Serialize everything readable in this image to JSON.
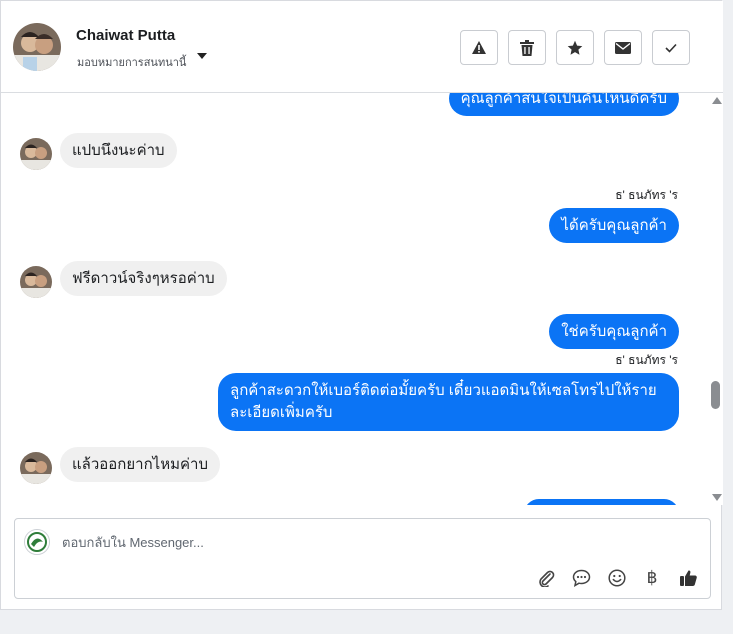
{
  "header": {
    "user_name": "Chaiwat Putta",
    "subtitle": "มอบหมายการสนทนานี้",
    "buttons": [
      {
        "icon": "warning-icon",
        "label": "report"
      },
      {
        "icon": "trash-icon",
        "label": "delete"
      },
      {
        "icon": "star-icon",
        "label": "star"
      },
      {
        "icon": "envelope-icon",
        "label": "mark unread"
      },
      {
        "icon": "check-icon",
        "label": "done"
      }
    ]
  },
  "messages": [
    {
      "direction": "out",
      "text": "คุณลูกค้าสนใจเป็นคันไหนดีครับ"
    },
    {
      "direction": "in",
      "text": "แปบนึงนะค่าบ"
    },
    {
      "direction": "out",
      "sender": "ธ' ธนภัทร 'ร",
      "text": "ได้ครับคุณลูกค้า"
    },
    {
      "direction": "in",
      "text": "ฟรีดาวน์จริงๆหรอค่าบ"
    },
    {
      "direction": "out",
      "text": "ใช่ครับคุณลูกค้า"
    },
    {
      "direction": "out",
      "sender": "ธ' ธนภัทร 'ร",
      "text": "ลูกค้าสะดวกให้เบอร์ติดต่อมั้ยครับ เดี๋ยวแอดมินให้เซลโทรไปให้รายละเอียดเพิ่มครับ"
    },
    {
      "direction": "in",
      "text": "แล้วออกยากไหมค่าบ"
    }
  ],
  "composer": {
    "placeholder": "ตอบกลับใน Messenger...",
    "tools": [
      "paperclip-icon",
      "chat-bubble-icon",
      "smiley-icon",
      "baht-icon",
      "thumbs-up-icon"
    ],
    "baht_symbol": "฿"
  },
  "colors": {
    "outgoing_bubble": "#0b74f5",
    "incoming_bubble": "#f0f0f0",
    "accent": "#0b74f5"
  }
}
